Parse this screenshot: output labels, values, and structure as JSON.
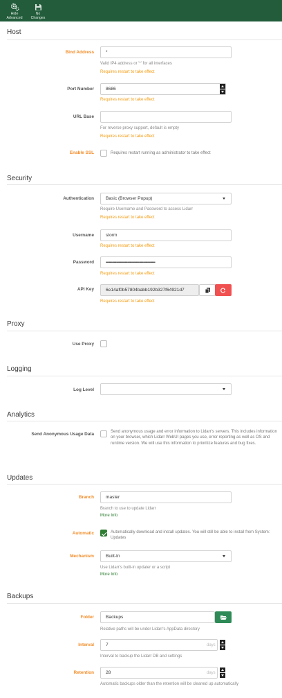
{
  "toolbar": {
    "hide_advanced_label": "Hide\nAdvanced",
    "no_changes_label": "No\nChanges"
  },
  "host": {
    "title": "Host",
    "bind_address": {
      "label": "Bind Address",
      "value": "*",
      "help": "Valid IP4 address or '*' for all interfaces",
      "warning": "Requires restart to take effect"
    },
    "port_number": {
      "label": "Port Number",
      "value": "8686",
      "warning": "Requires restart to take effect"
    },
    "url_base": {
      "label": "URL Base",
      "value": "",
      "help": "For reverse proxy support, default is empty",
      "warning": "Requires restart to take effect"
    },
    "enable_ssl": {
      "label": "Enable SSL",
      "text": "Requires restart running as administrator to take effect"
    }
  },
  "security": {
    "title": "Security",
    "authentication": {
      "label": "Authentication",
      "value": "Basic (Browser Popup)",
      "help": "Require Username and Password to access Lidarr",
      "warning": "Requires restart to take effect"
    },
    "username": {
      "label": "Username",
      "value": "storm",
      "warning": "Requires restart to take effect"
    },
    "password": {
      "label": "Password",
      "value": "••••••••••••••••••••••••••••••••••••••••••••••••••••••••••••••",
      "warning": "Requires restart to take effect"
    },
    "api_key": {
      "label": "API Key",
      "value": "6e14af0b57804babb192b327f64921d7",
      "warning": "Requires restart to take effect"
    }
  },
  "proxy": {
    "title": "Proxy",
    "use_proxy": {
      "label": "Use Proxy"
    }
  },
  "logging": {
    "title": "Logging",
    "log_level": {
      "label": "Log Level",
      "value": ""
    }
  },
  "analytics": {
    "title": "Analytics",
    "usage_data": {
      "label": "Send Anonymous Usage Data",
      "text": "Send anonymous usage and error information to Lidarr's servers. This includes information on your browser, which Lidarr WebUI pages you use, error reporting as well as OS and runtime version. We will use this information to prioritize features and bug fixes."
    }
  },
  "updates": {
    "title": "Updates",
    "branch": {
      "label": "Branch",
      "value": "master",
      "help": "Branch to use to update Lidarr",
      "link": "More Info"
    },
    "automatic": {
      "label": "Automatic",
      "checked": true,
      "text": "Automatically download and install updates. You will still be able to install from System: Updates"
    },
    "mechanism": {
      "label": "Mechanism",
      "value": "Built-In",
      "help": "Use Lidarr's built-in updater or a script",
      "link": "More Info"
    }
  },
  "backups": {
    "title": "Backups",
    "folder": {
      "label": "Folder",
      "value": "Backups",
      "help": "Relative paths will be under Lidarr's AppData directory"
    },
    "interval": {
      "label": "Interval",
      "value": "7",
      "units": "days",
      "help": "Interval to backup the Lidarr DB and settings"
    },
    "retention": {
      "label": "Retention",
      "value": "28",
      "units": "days",
      "help": "Automatic backups older than the retention will be cleaned up automatically"
    }
  },
  "colors": {
    "toolbar_bg": "#225c3b",
    "advanced_label": "#f28c28",
    "warning": "#f39c12",
    "link": "#2e7d32",
    "danger": "#f05050"
  }
}
